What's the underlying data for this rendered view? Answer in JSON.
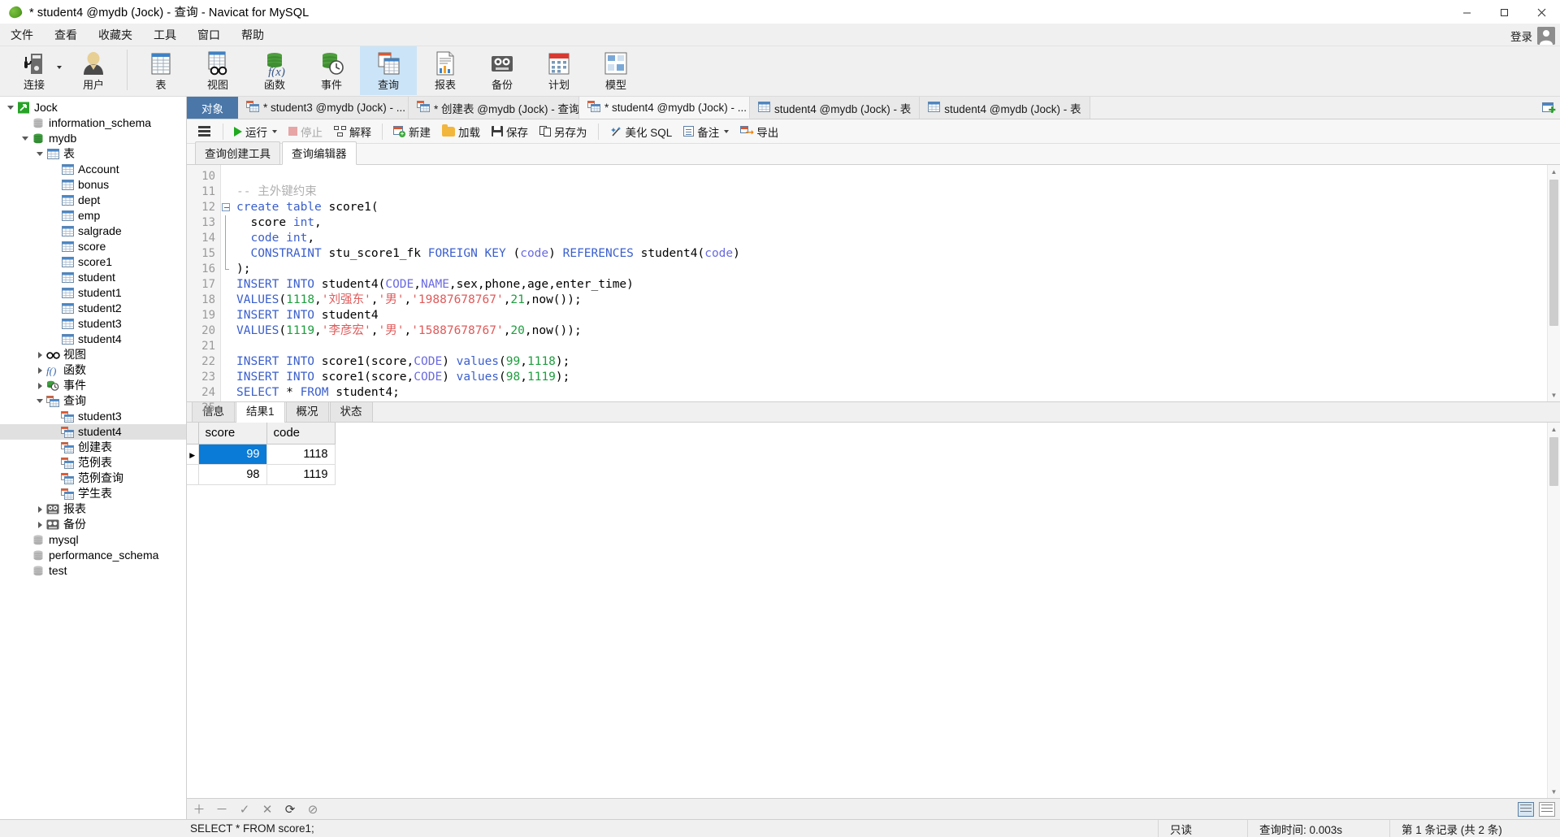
{
  "window": {
    "title": "* student4 @mydb (Jock) - 查询 - Navicat for MySQL",
    "minimize": "minimize-icon",
    "maximize": "maximize-icon",
    "close": "close-icon"
  },
  "menubar": {
    "items": [
      "文件",
      "查看",
      "收藏夹",
      "工具",
      "窗口",
      "帮助"
    ],
    "login_label": "登录"
  },
  "ribbon": {
    "buttons": [
      {
        "label": "连接",
        "icon": "connection-icon",
        "has_caret": true,
        "active": false
      },
      {
        "label": "用户",
        "icon": "user-icon",
        "has_caret": false,
        "active": false
      },
      {
        "label": "表",
        "icon": "table-icon",
        "has_caret": false,
        "active": false
      },
      {
        "label": "视图",
        "icon": "view-icon",
        "has_caret": false,
        "active": false
      },
      {
        "label": "函数",
        "icon": "function-icon",
        "has_caret": false,
        "active": false
      },
      {
        "label": "事件",
        "icon": "event-icon",
        "has_caret": false,
        "active": false
      },
      {
        "label": "查询",
        "icon": "query-icon",
        "has_caret": false,
        "active": true
      },
      {
        "label": "报表",
        "icon": "report-icon",
        "has_caret": false,
        "active": false
      },
      {
        "label": "备份",
        "icon": "backup-icon",
        "has_caret": false,
        "active": false
      },
      {
        "label": "计划",
        "icon": "schedule-icon",
        "has_caret": false,
        "active": false
      },
      {
        "label": "模型",
        "icon": "model-icon",
        "has_caret": false,
        "active": false
      }
    ]
  },
  "sidebar": {
    "nodes": [
      {
        "label": "Jock",
        "indent": 0,
        "twisty": "down",
        "icon": "connection-icon",
        "selected": false
      },
      {
        "label": "information_schema",
        "indent": 1,
        "twisty": "none",
        "icon": "database-gray-icon",
        "selected": false
      },
      {
        "label": "mydb",
        "indent": 1,
        "twisty": "down",
        "icon": "database-green-icon",
        "selected": false
      },
      {
        "label": "表",
        "indent": 2,
        "twisty": "down",
        "icon": "table-icon",
        "selected": false
      },
      {
        "label": "Account",
        "indent": 3,
        "twisty": "none",
        "icon": "table-icon",
        "selected": false
      },
      {
        "label": "bonus",
        "indent": 3,
        "twisty": "none",
        "icon": "table-icon",
        "selected": false
      },
      {
        "label": "dept",
        "indent": 3,
        "twisty": "none",
        "icon": "table-icon",
        "selected": false
      },
      {
        "label": "emp",
        "indent": 3,
        "twisty": "none",
        "icon": "table-icon",
        "selected": false
      },
      {
        "label": "salgrade",
        "indent": 3,
        "twisty": "none",
        "icon": "table-icon",
        "selected": false
      },
      {
        "label": "score",
        "indent": 3,
        "twisty": "none",
        "icon": "table-icon",
        "selected": false
      },
      {
        "label": "score1",
        "indent": 3,
        "twisty": "none",
        "icon": "table-icon",
        "selected": false
      },
      {
        "label": "student",
        "indent": 3,
        "twisty": "none",
        "icon": "table-icon",
        "selected": false
      },
      {
        "label": "student1",
        "indent": 3,
        "twisty": "none",
        "icon": "table-icon",
        "selected": false
      },
      {
        "label": "student2",
        "indent": 3,
        "twisty": "none",
        "icon": "table-icon",
        "selected": false
      },
      {
        "label": "student3",
        "indent": 3,
        "twisty": "none",
        "icon": "table-icon",
        "selected": false
      },
      {
        "label": "student4",
        "indent": 3,
        "twisty": "none",
        "icon": "table-icon",
        "selected": false
      },
      {
        "label": "视图",
        "indent": 2,
        "twisty": "right",
        "icon": "view-icon",
        "selected": false
      },
      {
        "label": "函数",
        "indent": 2,
        "twisty": "right",
        "icon": "function-icon",
        "selected": false
      },
      {
        "label": "事件",
        "indent": 2,
        "twisty": "right",
        "icon": "event-icon",
        "selected": false
      },
      {
        "label": "查询",
        "indent": 2,
        "twisty": "down",
        "icon": "query-icon",
        "selected": false
      },
      {
        "label": "student3",
        "indent": 3,
        "twisty": "none",
        "icon": "query-icon",
        "selected": false
      },
      {
        "label": "student4",
        "indent": 3,
        "twisty": "none",
        "icon": "query-icon",
        "selected": true
      },
      {
        "label": "创建表",
        "indent": 3,
        "twisty": "none",
        "icon": "query-icon",
        "selected": false
      },
      {
        "label": "范例表",
        "indent": 3,
        "twisty": "none",
        "icon": "query-icon",
        "selected": false
      },
      {
        "label": "范例查询",
        "indent": 3,
        "twisty": "none",
        "icon": "query-icon",
        "selected": false
      },
      {
        "label": "学生表",
        "indent": 3,
        "twisty": "none",
        "icon": "query-icon",
        "selected": false
      },
      {
        "label": "报表",
        "indent": 2,
        "twisty": "right",
        "icon": "report-icon",
        "selected": false
      },
      {
        "label": "备份",
        "indent": 2,
        "twisty": "right",
        "icon": "backup-icon",
        "selected": false
      },
      {
        "label": "mysql",
        "indent": 1,
        "twisty": "none",
        "icon": "database-gray-icon",
        "selected": false
      },
      {
        "label": "performance_schema",
        "indent": 1,
        "twisty": "none",
        "icon": "database-gray-icon",
        "selected": false
      },
      {
        "label": "test",
        "indent": 1,
        "twisty": "none",
        "icon": "database-gray-icon",
        "selected": false
      }
    ]
  },
  "doctabs": {
    "object_tab": "对象",
    "tabs": [
      {
        "label": "* student3 @mydb (Jock) - ...",
        "icon": "query-icon",
        "active": false
      },
      {
        "label": "* 创建表 @mydb (Jock) - 查询",
        "icon": "query-icon",
        "active": false
      },
      {
        "label": "* student4 @mydb (Jock) - ...",
        "icon": "query-icon",
        "active": true
      },
      {
        "label": "student4 @mydb (Jock) - 表",
        "icon": "table-icon",
        "active": false
      },
      {
        "label": "student4 @mydb (Jock) - 表",
        "icon": "table-icon",
        "active": false
      }
    ],
    "add_tab_icon": "new-tab-icon"
  },
  "query_toolbar": {
    "menu_icon": "hamburger-icon",
    "buttons": [
      {
        "label": "运行",
        "icon": "run-icon",
        "caret": true,
        "disabled": false
      },
      {
        "label": "停止",
        "icon": "stop-icon",
        "caret": false,
        "disabled": true
      },
      {
        "label": "解释",
        "icon": "explain-icon",
        "caret": false,
        "disabled": false
      },
      {
        "label": "新建",
        "icon": "new-query-icon",
        "caret": false,
        "disabled": false
      },
      {
        "label": "加载",
        "icon": "open-folder-icon",
        "caret": false,
        "disabled": false
      },
      {
        "label": "保存",
        "icon": "save-icon",
        "caret": false,
        "disabled": false
      },
      {
        "label": "另存为",
        "icon": "save-as-icon",
        "caret": false,
        "disabled": false
      },
      {
        "label": "美化 SQL",
        "icon": "magic-wand-icon",
        "caret": false,
        "disabled": false
      },
      {
        "label": "备注",
        "icon": "note-icon",
        "caret": true,
        "disabled": false
      },
      {
        "label": "导出",
        "icon": "export-icon",
        "caret": false,
        "disabled": false
      }
    ]
  },
  "inner_tabs": [
    {
      "label": "查询创建工具",
      "active": false
    },
    {
      "label": "查询编辑器",
      "active": true
    }
  ],
  "editor": {
    "first_line": 10,
    "lines": [
      {
        "n": 10,
        "fold": "none",
        "tokens": []
      },
      {
        "n": 11,
        "fold": "none",
        "tokens": [
          {
            "t": "-- 主外键约束",
            "c": "cmt"
          }
        ]
      },
      {
        "n": 12,
        "fold": "start",
        "tokens": [
          {
            "t": "create table",
            "c": "kw"
          },
          {
            "t": " score1(",
            "c": "id"
          }
        ]
      },
      {
        "n": 13,
        "fold": "mid",
        "tokens": [
          {
            "t": "  score ",
            "c": "id"
          },
          {
            "t": "int",
            "c": "kw"
          },
          {
            "t": ",",
            "c": "id"
          }
        ]
      },
      {
        "n": 14,
        "fold": "mid",
        "tokens": [
          {
            "t": "  code int",
            "c": "kw"
          },
          {
            "t": ",",
            "c": "id"
          }
        ]
      },
      {
        "n": 15,
        "fold": "mid",
        "tokens": [
          {
            "t": "  CONSTRAINT ",
            "c": "kw"
          },
          {
            "t": "stu_score1_fk ",
            "c": "id"
          },
          {
            "t": "FOREIGN KEY ",
            "c": "kw"
          },
          {
            "t": "(",
            "c": "id"
          },
          {
            "t": "code",
            "c": "col"
          },
          {
            "t": ") ",
            "c": "id"
          },
          {
            "t": "REFERENCES ",
            "c": "kw"
          },
          {
            "t": "student4(",
            "c": "id"
          },
          {
            "t": "code",
            "c": "col"
          },
          {
            "t": ")",
            "c": "id"
          }
        ]
      },
      {
        "n": 16,
        "fold": "end",
        "tokens": [
          {
            "t": ");",
            "c": "id"
          }
        ]
      },
      {
        "n": 17,
        "fold": "none",
        "tokens": [
          {
            "t": "INSERT INTO ",
            "c": "kw"
          },
          {
            "t": "student4(",
            "c": "id"
          },
          {
            "t": "CODE",
            "c": "col"
          },
          {
            "t": ",",
            "c": "id"
          },
          {
            "t": "NAME",
            "c": "col"
          },
          {
            "t": ",sex,phone,age,enter_time)",
            "c": "id"
          }
        ]
      },
      {
        "n": 18,
        "fold": "none",
        "tokens": [
          {
            "t": "VALUES",
            "c": "kw"
          },
          {
            "t": "(",
            "c": "id"
          },
          {
            "t": "1118",
            "c": "num"
          },
          {
            "t": ",",
            "c": "id"
          },
          {
            "t": "'刘强东'",
            "c": "str"
          },
          {
            "t": ",",
            "c": "id"
          },
          {
            "t": "'男'",
            "c": "str"
          },
          {
            "t": ",",
            "c": "id"
          },
          {
            "t": "'19887678767'",
            "c": "str"
          },
          {
            "t": ",",
            "c": "id"
          },
          {
            "t": "21",
            "c": "num"
          },
          {
            "t": ",now());",
            "c": "id"
          }
        ]
      },
      {
        "n": 19,
        "fold": "none",
        "tokens": [
          {
            "t": "INSERT INTO ",
            "c": "kw"
          },
          {
            "t": "student4",
            "c": "id"
          }
        ]
      },
      {
        "n": 20,
        "fold": "none",
        "tokens": [
          {
            "t": "VALUES",
            "c": "kw"
          },
          {
            "t": "(",
            "c": "id"
          },
          {
            "t": "1119",
            "c": "num"
          },
          {
            "t": ",",
            "c": "id"
          },
          {
            "t": "'李彦宏'",
            "c": "str"
          },
          {
            "t": ",",
            "c": "id"
          },
          {
            "t": "'男'",
            "c": "str"
          },
          {
            "t": ",",
            "c": "id"
          },
          {
            "t": "'15887678767'",
            "c": "str"
          },
          {
            "t": ",",
            "c": "id"
          },
          {
            "t": "20",
            "c": "num"
          },
          {
            "t": ",now());",
            "c": "id"
          }
        ]
      },
      {
        "n": 21,
        "fold": "none",
        "tokens": []
      },
      {
        "n": 22,
        "fold": "none",
        "tokens": [
          {
            "t": "INSERT INTO ",
            "c": "kw"
          },
          {
            "t": "score1(score,",
            "c": "id"
          },
          {
            "t": "CODE",
            "c": "col"
          },
          {
            "t": ") ",
            "c": "id"
          },
          {
            "t": "values",
            "c": "kw"
          },
          {
            "t": "(",
            "c": "id"
          },
          {
            "t": "99",
            "c": "num"
          },
          {
            "t": ",",
            "c": "id"
          },
          {
            "t": "1118",
            "c": "num"
          },
          {
            "t": ");",
            "c": "id"
          }
        ]
      },
      {
        "n": 23,
        "fold": "none",
        "tokens": [
          {
            "t": "INSERT INTO ",
            "c": "kw"
          },
          {
            "t": "score1(score,",
            "c": "id"
          },
          {
            "t": "CODE",
            "c": "col"
          },
          {
            "t": ") ",
            "c": "id"
          },
          {
            "t": "values",
            "c": "kw"
          },
          {
            "t": "(",
            "c": "id"
          },
          {
            "t": "98",
            "c": "num"
          },
          {
            "t": ",",
            "c": "id"
          },
          {
            "t": "1119",
            "c": "num"
          },
          {
            "t": ");",
            "c": "id"
          }
        ]
      },
      {
        "n": 24,
        "fold": "none",
        "tokens": [
          {
            "t": "SELECT ",
            "c": "kw"
          },
          {
            "t": "* ",
            "c": "id"
          },
          {
            "t": "FROM ",
            "c": "kw"
          },
          {
            "t": "student4;",
            "c": "id"
          }
        ]
      },
      {
        "n": 25,
        "fold": "none",
        "selected": true,
        "tokens": [
          {
            "t": "SELECT * FROM score1;",
            "c": "id"
          }
        ]
      }
    ]
  },
  "result_tabs": [
    {
      "label": "信息",
      "active": false
    },
    {
      "label": "结果1",
      "active": true
    },
    {
      "label": "概况",
      "active": false
    },
    {
      "label": "状态",
      "active": false
    }
  ],
  "result_grid": {
    "columns": [
      "score",
      "code"
    ],
    "rows": [
      {
        "current": true,
        "cells": [
          "99",
          "1118"
        ]
      },
      {
        "current": false,
        "cells": [
          "98",
          "1119"
        ]
      }
    ]
  },
  "grid_footer": {
    "buttons": [
      "add-record-icon",
      "delete-record-icon",
      "apply-icon",
      "cancel-icon",
      "refresh-icon",
      "stop-icon"
    ],
    "view_grid_icon": "grid-view-icon",
    "view_form_icon": "form-view-icon"
  },
  "statusbar": {
    "query": "SELECT * FROM score1;",
    "readonly": "只读",
    "query_time": "查询时间: 0.003s",
    "record_info": "第 1 条记录 (共 2 条)"
  }
}
